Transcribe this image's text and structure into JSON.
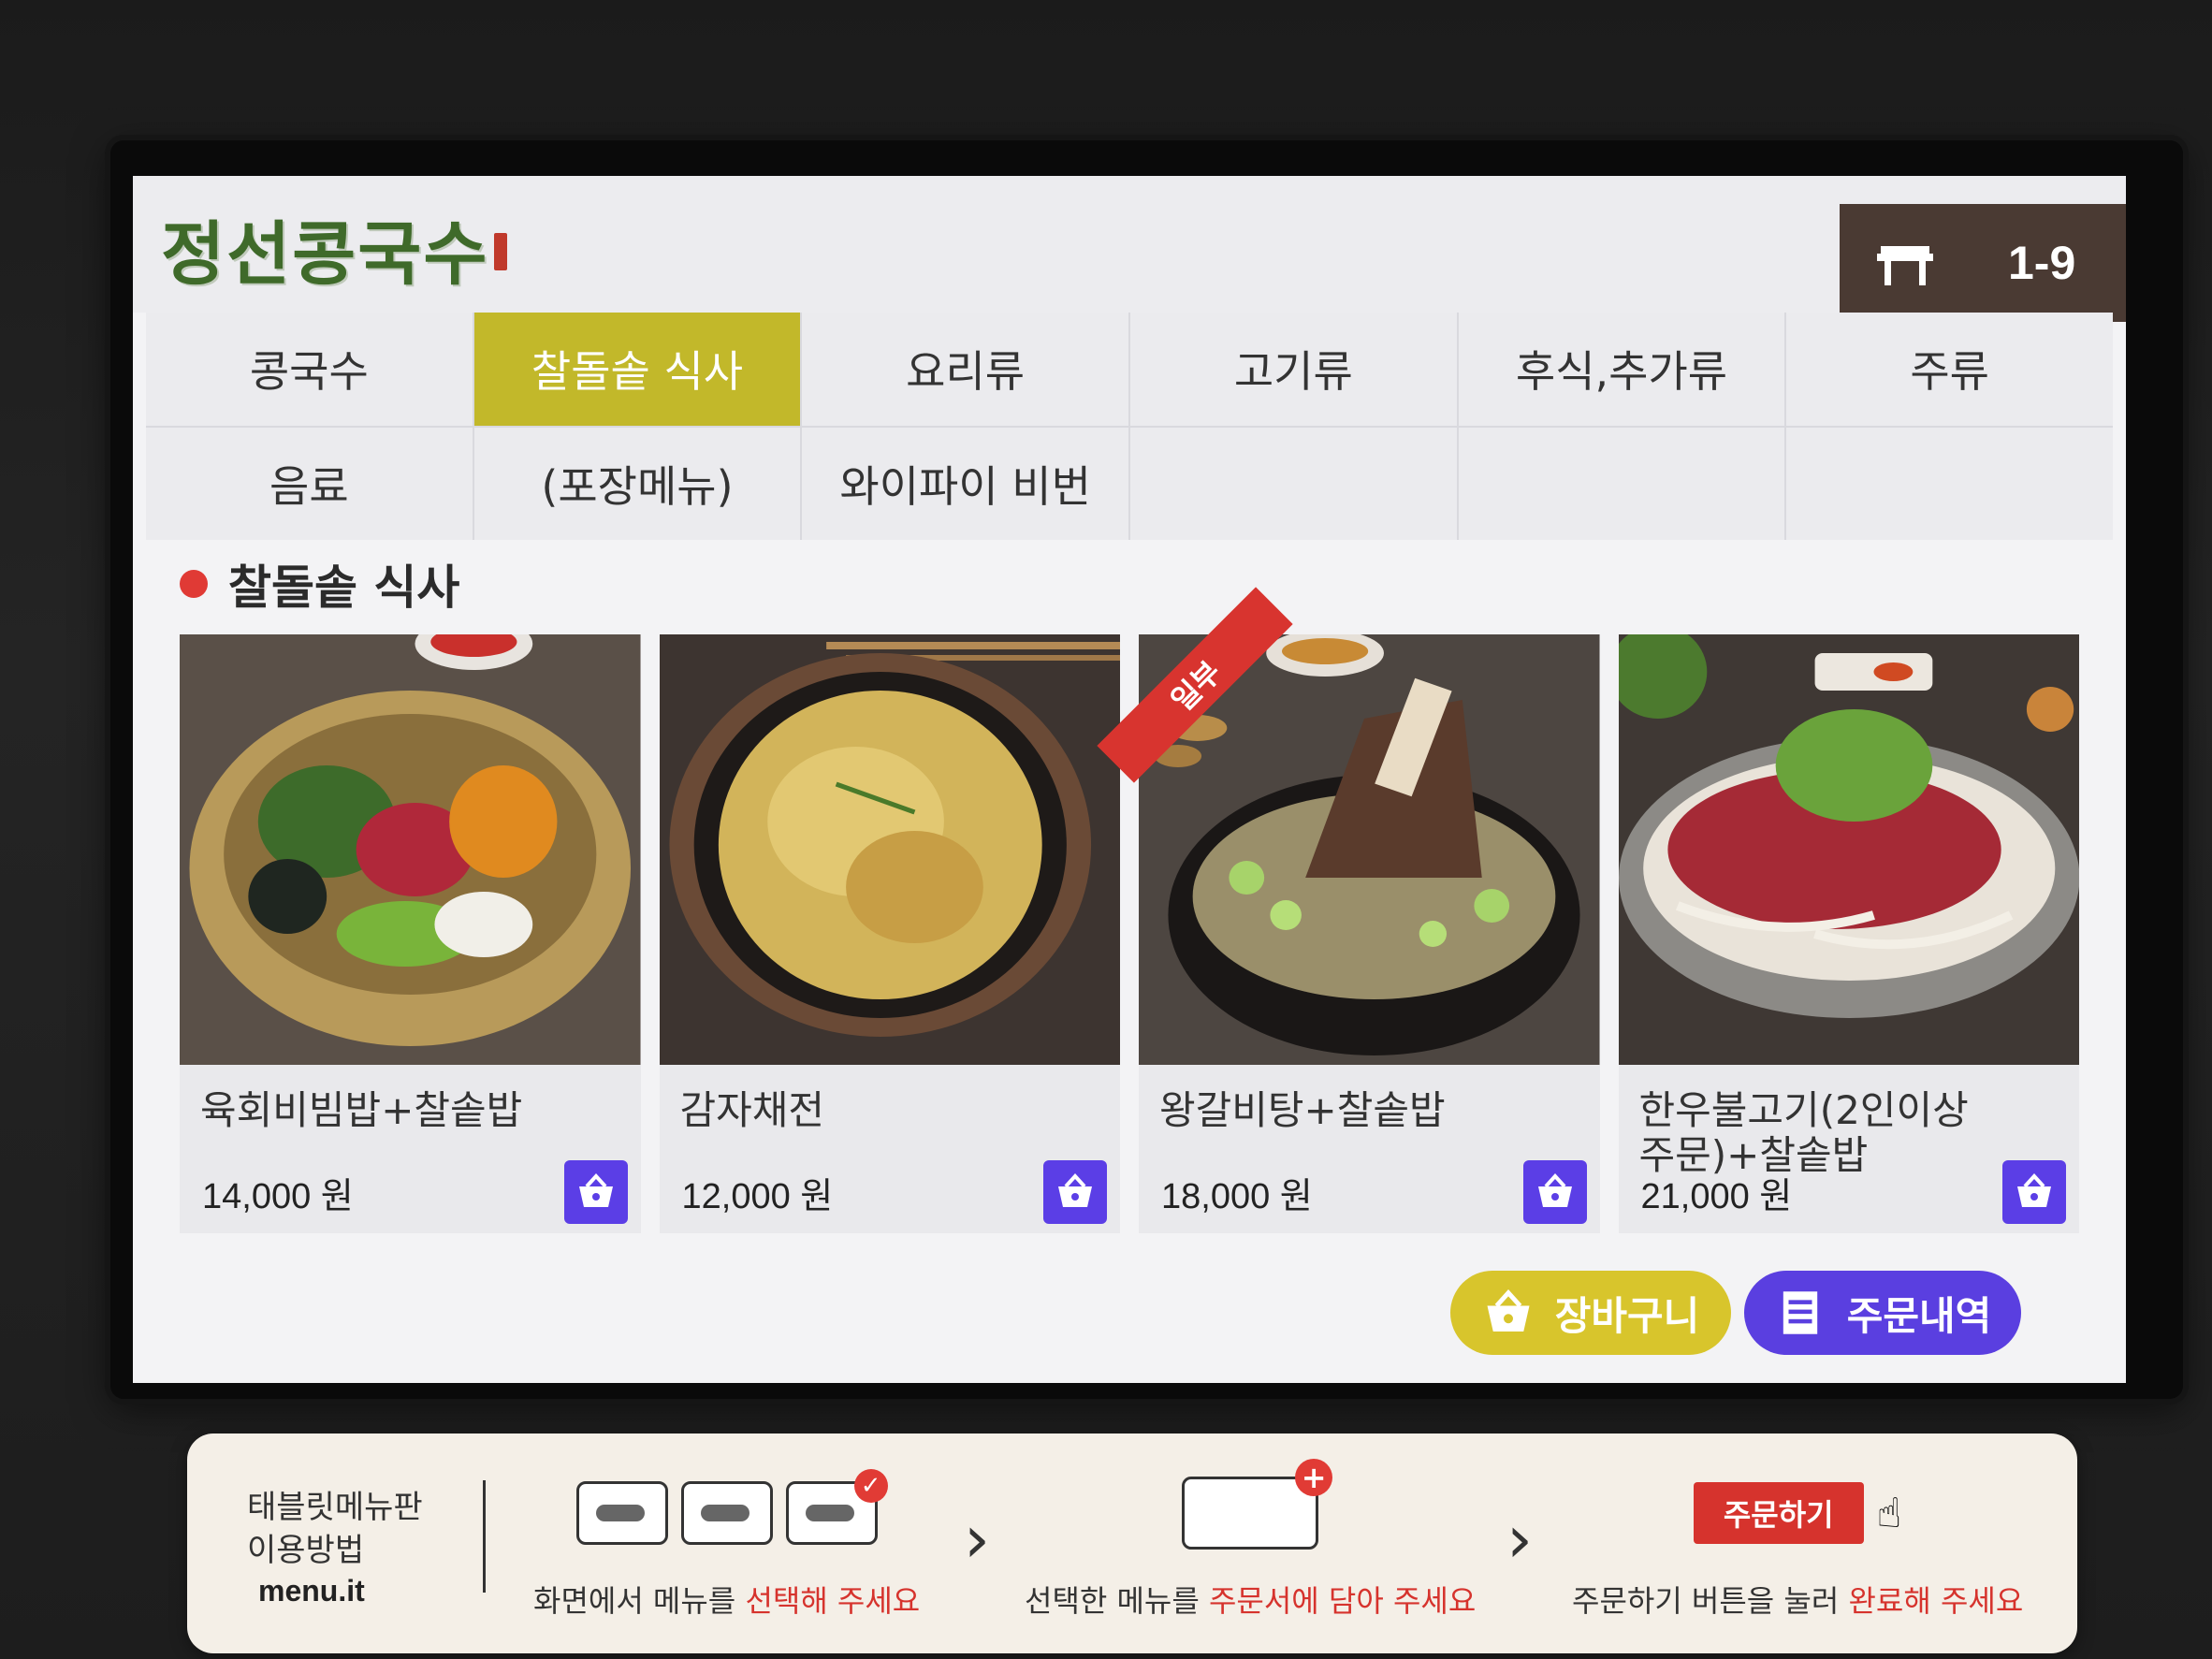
{
  "header": {
    "logo_text": "정선콩국수",
    "table_number": "1-9",
    "table_icon": "table-icon"
  },
  "categories": [
    {
      "label": "콩국수",
      "active": false
    },
    {
      "label": "찰돌솥 식사",
      "active": true
    },
    {
      "label": "요리류",
      "active": false
    },
    {
      "label": "고기류",
      "active": false
    },
    {
      "label": "후식,추가류",
      "active": false
    },
    {
      "label": "주류",
      "active": false
    },
    {
      "label": "음료",
      "active": false
    },
    {
      "label": "(포장메뉴)",
      "active": false
    },
    {
      "label": "와이파이 비번",
      "active": false
    },
    {
      "label": "",
      "active": false
    },
    {
      "label": "",
      "active": false
    },
    {
      "label": "",
      "active": false
    }
  ],
  "section": {
    "title": "찰돌솥 식사"
  },
  "menu_items": [
    {
      "name": "육회비빔밥+찰솥밥",
      "price": "14,000 원",
      "badge": ""
    },
    {
      "name": "감자채전",
      "price": "12,000 원",
      "badge": ""
    },
    {
      "name": "왕갈비탕+찰솥밥",
      "price": "18,000 원",
      "badge": "일부"
    },
    {
      "name": "한우불고기(2인이상주문)+찰솥밥",
      "price": "21,000 원",
      "badge": ""
    }
  ],
  "actions": {
    "basket_label": "장바구니",
    "orders_label": "주문내역"
  },
  "guide": {
    "title_line1": "태블릿메뉴판",
    "title_line2": "이용방법",
    "brand": "menu.it",
    "step1_pre": "화면에서 메뉴를 ",
    "step1_hl": "선택해 주세요",
    "step2_pre": "선택한 메뉴를 ",
    "step2_hl": "주문서에 담아 주세요",
    "step3_chip": "주문하기",
    "step3_pre": "주문하기 버튼을 눌러 ",
    "step3_hl": "완료해 주세요"
  },
  "colors": {
    "accent_yellow": "#c2b82a",
    "accent_purple": "#5b3ee6",
    "accent_red": "#d6332d",
    "header_brown": "#4a3a33"
  }
}
